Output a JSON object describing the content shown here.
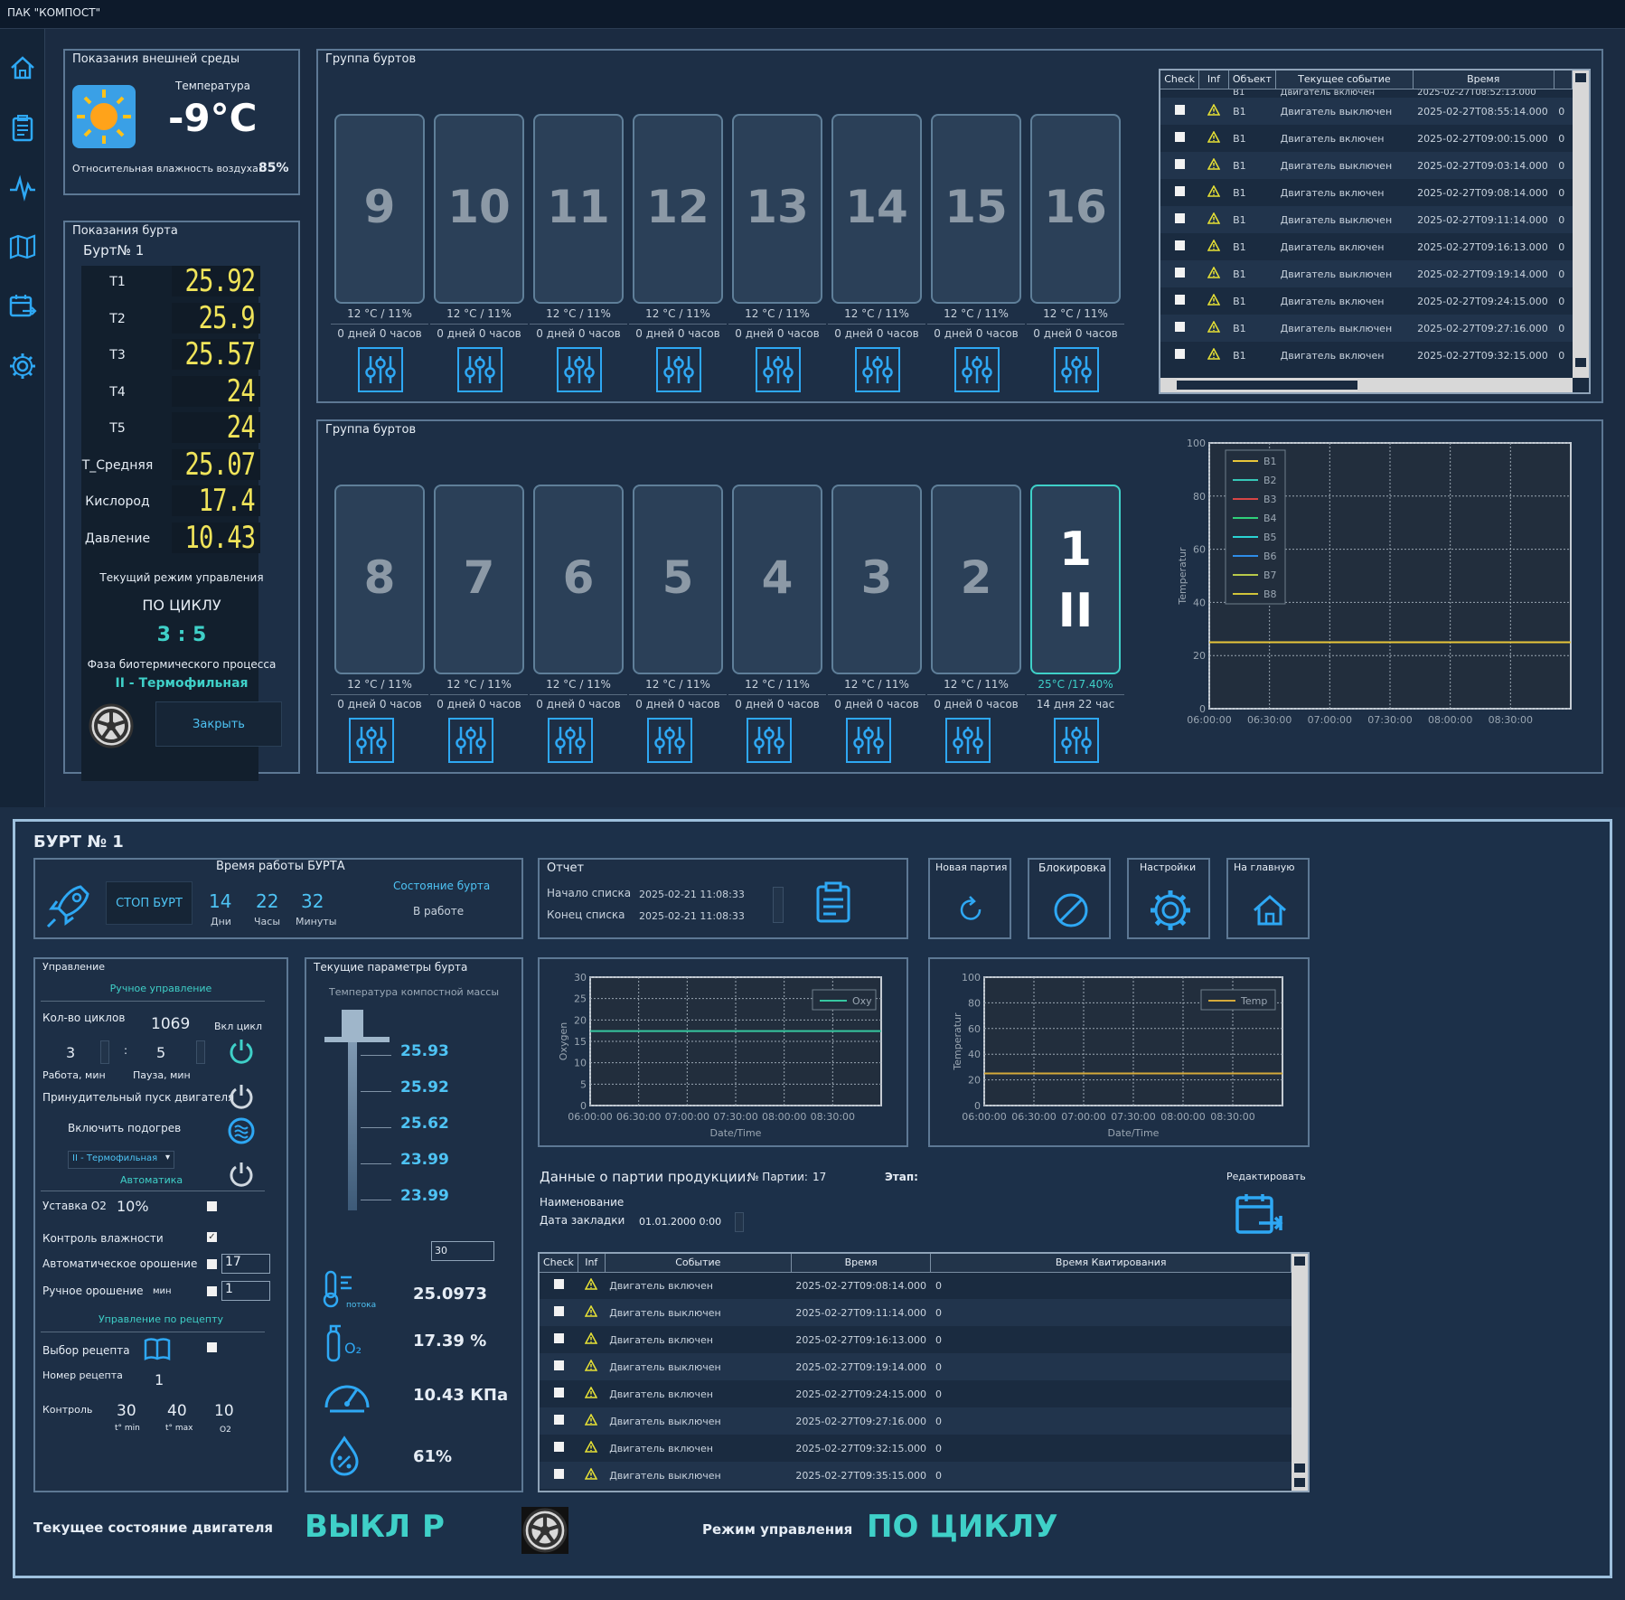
{
  "window": {
    "title": "ПАК \"КОМПОСТ\""
  },
  "env": {
    "title": "Показания внешней среды",
    "temp_label": "Температура",
    "temp_value": "-9°C",
    "humidity_label": "Относительная влажность воздуха:",
    "humidity_value": "85%"
  },
  "burt": {
    "title": "Показания бурта",
    "name": "Бурт№ 1",
    "rows": [
      {
        "label": "T1",
        "value": "25.92"
      },
      {
        "label": "T2",
        "value": "25.9"
      },
      {
        "label": "T3",
        "value": "25.57"
      },
      {
        "label": "T4",
        "value": "24"
      },
      {
        "label": "T5",
        "value": "24"
      },
      {
        "label": "T_Средняя",
        "value": "25.07"
      },
      {
        "label": "Кислород",
        "value": "17.4"
      },
      {
        "label": "Давление",
        "value": "10.43"
      }
    ],
    "mode_label": "Текущий режим управления",
    "mode_value": "ПО ЦИКЛУ",
    "cycle": "3 : 5",
    "phase_label": "Фаза биотермического процесса",
    "phase_value": "II - Термофильная",
    "close_button": "Закрыть"
  },
  "group1": {
    "title": "Группа буртов",
    "tiles": [
      {
        "num": "9",
        "cond": "12 °C / 11%",
        "age": "0 дней 0 часов"
      },
      {
        "num": "10",
        "cond": "12 °C / 11%",
        "age": "0 дней 0 часов"
      },
      {
        "num": "11",
        "cond": "12 °C / 11%",
        "age": "0 дней 0 часов"
      },
      {
        "num": "12",
        "cond": "12 °C / 11%",
        "age": "0 дней 0 часов"
      },
      {
        "num": "13",
        "cond": "12 °C / 11%",
        "age": "0 дней 0 часов"
      },
      {
        "num": "14",
        "cond": "12 °C / 11%",
        "age": "0 дней 0 часов"
      },
      {
        "num": "15",
        "cond": "12 °C / 11%",
        "age": "0 дней 0 часов"
      },
      {
        "num": "16",
        "cond": "12 °C / 11%",
        "age": "0 дней 0 часов"
      }
    ]
  },
  "group2": {
    "title": "Группа буртов",
    "tiles": [
      {
        "num": "8",
        "cond": "12 °C / 11%",
        "age": "0 дней 0 часов"
      },
      {
        "num": "7",
        "cond": "12 °C / 11%",
        "age": "0 дней 0 часов"
      },
      {
        "num": "6",
        "cond": "12 °C / 11%",
        "age": "0 дней 0 часов"
      },
      {
        "num": "5",
        "cond": "12 °C / 11%",
        "age": "0 дней 0 часов"
      },
      {
        "num": "4",
        "cond": "12 °C / 11%",
        "age": "0 дней 0 часов"
      },
      {
        "num": "3",
        "cond": "12 °C / 11%",
        "age": "0 дней 0 часов"
      },
      {
        "num": "2",
        "cond": "12 °C / 11%",
        "age": "0 дней 0 часов"
      },
      {
        "num": "1",
        "phase": "II",
        "cond": "25°C /17.40%",
        "age": "14 дня 22 час"
      }
    ]
  },
  "events_top": {
    "headers": [
      "Check",
      "Inf",
      "Объект",
      "Текущее событие",
      "Время"
    ],
    "partial": {
      "object": "B1",
      "event": "Двигатель включен",
      "time": "2025-02-27T08:52:13.000"
    },
    "rows": [
      {
        "object": "B1",
        "event": "Двигатель выключен",
        "time": "2025-02-27T08:55:14.000",
        "ack": "0"
      },
      {
        "object": "B1",
        "event": "Двигатель включен",
        "time": "2025-02-27T09:00:15.000",
        "ack": "0"
      },
      {
        "object": "B1",
        "event": "Двигатель выключен",
        "time": "2025-02-27T09:03:14.000",
        "ack": "0"
      },
      {
        "object": "B1",
        "event": "Двигатель включен",
        "time": "2025-02-27T09:08:14.000",
        "ack": "0"
      },
      {
        "object": "B1",
        "event": "Двигатель выключен",
        "time": "2025-02-27T09:11:14.000",
        "ack": "0"
      },
      {
        "object": "B1",
        "event": "Двигатель включен",
        "time": "2025-02-27T09:16:13.000",
        "ack": "0"
      },
      {
        "object": "B1",
        "event": "Двигатель выключен",
        "time": "2025-02-27T09:19:14.000",
        "ack": "0"
      },
      {
        "object": "B1",
        "event": "Двигатель включен",
        "time": "2025-02-27T09:24:15.000",
        "ack": "0"
      },
      {
        "object": "B1",
        "event": "Двигатель выключен",
        "time": "2025-02-27T09:27:16.000",
        "ack": "0"
      },
      {
        "object": "B1",
        "event": "Двигатель включен",
        "time": "2025-02-27T09:32:15.000",
        "ack": "0"
      }
    ]
  },
  "chart_data": [
    {
      "type": "line",
      "title": "",
      "xlabel": "Date/Time",
      "ylabel": "Temperatur",
      "ylim": [
        0,
        100
      ],
      "yticks": [
        "0",
        "20",
        "40",
        "60",
        "80",
        "100"
      ],
      "x": [
        "06:00:00",
        "06:30:00",
        "07:00:00",
        "07:30:00",
        "08:00:00",
        "08:30:00"
      ],
      "series": [
        {
          "name": "B1",
          "color": "#e8c63a",
          "values": [
            25,
            25,
            25,
            25,
            25,
            25
          ]
        },
        {
          "name": "B2",
          "color": "#36c7b8",
          "values": []
        },
        {
          "name": "B3",
          "color": "#d64545",
          "values": []
        },
        {
          "name": "B4",
          "color": "#2fd07a",
          "values": []
        },
        {
          "name": "B5",
          "color": "#2ad3d3",
          "values": []
        },
        {
          "name": "B6",
          "color": "#2e8de8",
          "values": []
        },
        {
          "name": "B7",
          "color": "#b8c94a",
          "values": []
        },
        {
          "name": "B8",
          "color": "#d1c43a",
          "values": []
        }
      ],
      "legend": "top-left"
    },
    {
      "type": "line",
      "title": "",
      "xlabel": "Date/Time",
      "ylabel": "Oxygen",
      "ylim": [
        0,
        30
      ],
      "yticks": [
        "0",
        "5",
        "10",
        "15",
        "20",
        "25",
        "30"
      ],
      "x": [
        "06:00:00",
        "06:30:00",
        "07:00:00",
        "07:30:00",
        "08:00:00",
        "08:30:00"
      ],
      "series": [
        {
          "name": "Oxy",
          "color": "#36c7a0",
          "values": [
            17.4,
            17.4,
            17.4,
            17.4,
            17.4,
            17.4
          ]
        }
      ],
      "legend": "top-right"
    },
    {
      "type": "line",
      "title": "",
      "xlabel": "Date/Time",
      "ylabel": "Temperatur",
      "ylim": [
        0,
        100
      ],
      "yticks": [
        "0",
        "20",
        "40",
        "60",
        "80",
        "100"
      ],
      "x": [
        "06:00:00",
        "06:30:00",
        "07:00:00",
        "07:30:00",
        "08:00:00",
        "08:30:00"
      ],
      "series": [
        {
          "name": "Temp",
          "color": "#d4a93a",
          "values": [
            25,
            25,
            25,
            25,
            25,
            25
          ]
        }
      ],
      "legend": "top-right"
    }
  ],
  "detail": {
    "title": "БУРТ № 1",
    "work": {
      "title": "Время работы БУРТА",
      "stop_button": "СТОП БУРТ",
      "days": "14",
      "days_label": "Дни",
      "hours": "22",
      "hours_label": "Часы",
      "minutes": "32",
      "minutes_label": "Минуты",
      "state_label": "Состояние бурта",
      "state_value": "В работе"
    },
    "report": {
      "title": "Отчет",
      "start_label": "Начало списка",
      "start_value": "2025-02-21 11:08:33",
      "end_label": "Конец списка",
      "end_value": "2025-02-21 11:08:33"
    },
    "actions": {
      "new_batch": "Новая партия",
      "block": "Блокировка",
      "settings": "Настройки",
      "home": "На главную"
    },
    "control": {
      "title": "Управление",
      "manual": "Ручное управление",
      "cycles_label": "Кол-во циклов",
      "cycles_value": "1069",
      "cycle_on_label": "Вкл цикл",
      "work_value": "3",
      "work_label": "Работа, мин",
      "pause_value": "5",
      "pause_label": "Пауза, мин",
      "force_label": "Принудительный пуск двигателя",
      "heat_label": "Включить подогрев",
      "phase_select": "II - Термофильная",
      "auto_label": "Автоматика",
      "o2_label": "Уставка О2",
      "o2_value": "10%",
      "humidity_ctrl_label": "Контроль влажности",
      "auto_irr_label": "Автоматическое орошение",
      "auto_irr_value": "17",
      "manual_irr_label": "Ручное орошение",
      "manual_irr_unit": "мин",
      "manual_irr_value": "1",
      "recipe_title": "Управление по рецепту",
      "recipe_select_label": "Выбор рецепта",
      "recipe_num_label": "Номер рецепта",
      "recipe_num_value": "1",
      "control_label": "Контроль",
      "tmin": "30",
      "tmin_label": "t° min",
      "tmax": "40",
      "tmax_label": "t° max",
      "o2": "10",
      "o2_label2": "О2"
    },
    "params": {
      "title": "Текущие параметры бурта",
      "temp_title": "Температура компостной массы",
      "gauge_values": [
        "25.93",
        "25.92",
        "25.62",
        "23.99",
        "23.99"
      ],
      "spin_value": "30",
      "flow_label": "потока",
      "flow_value": "25.0973",
      "oxygen_value": "17.39 %",
      "pressure_value": "10.43 КПа",
      "humidity_value": "61%"
    },
    "batch": {
      "label": "Данные о партии продукции:",
      "number_label": "№ Партии:",
      "number_value": "17",
      "stage_label": "Этап:",
      "edit_label": "Редактировать",
      "name_label": "Наименование",
      "date_label": "Дата закладки",
      "date_value": "01.01.2000 0:00"
    },
    "events": {
      "headers": [
        "Check",
        "Inf",
        "Событие",
        "Время",
        "Время Квитирования"
      ],
      "rows": [
        {
          "event": "Двигатель включен",
          "time": "2025-02-27T09:08:14.000",
          "ack": "0"
        },
        {
          "event": "Двигатель выключен",
          "time": "2025-02-27T09:11:14.000",
          "ack": "0"
        },
        {
          "event": "Двигатель включен",
          "time": "2025-02-27T09:16:13.000",
          "ack": "0"
        },
        {
          "event": "Двигатель выключен",
          "time": "2025-02-27T09:19:14.000",
          "ack": "0"
        },
        {
          "event": "Двигатель включен",
          "time": "2025-02-27T09:24:15.000",
          "ack": "0"
        },
        {
          "event": "Двигатель выключен",
          "time": "2025-02-27T09:27:16.000",
          "ack": "0"
        },
        {
          "event": "Двигатель включен",
          "time": "2025-02-27T09:32:15.000",
          "ack": "0"
        },
        {
          "event": "Двигатель выключен",
          "time": "2025-02-27T09:35:15.000",
          "ack": "0"
        }
      ]
    },
    "status": {
      "engine_label": "Текущее состояние двигателя",
      "engine_value": "ВЫКЛ",
      "engine_letter": "Р",
      "mode_label": "Режим управления",
      "mode_value": "ПО ЦИКЛУ"
    }
  },
  "colors": {
    "accent": "#2ea8f4",
    "teal": "#3fd0c8",
    "lcd": "#f0e45a",
    "active_border": "#3fd0c8"
  },
  "icons": [
    "home-icon",
    "clipboard-icon",
    "pulse-icon",
    "map-icon",
    "calendar-export-icon",
    "gear-icon",
    "sun-icon",
    "sliders-icon",
    "warning-icon",
    "rocket-icon",
    "refresh-icon",
    "block-icon",
    "power-icon",
    "heater-icon",
    "thermometer-icon",
    "oxygen-icon",
    "gauge-icon",
    "drop-icon",
    "book-icon",
    "fan-wheel-icon"
  ]
}
